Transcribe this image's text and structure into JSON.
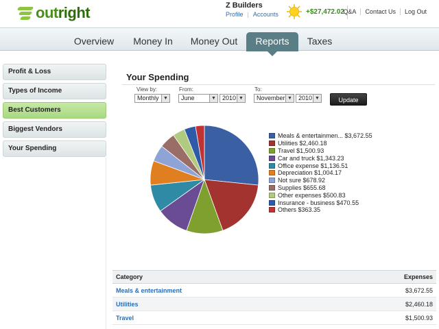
{
  "header": {
    "logo_text_a": "out",
    "logo_text_b": "right",
    "company": "Z Builders",
    "profile_link": "Profile",
    "accounts_link": "Accounts",
    "balance": "+$27,472.02",
    "links": [
      "Q&A",
      "Contact Us",
      "Log Out"
    ]
  },
  "nav": {
    "tabs": [
      "Overview",
      "Money In",
      "Money Out",
      "Reports",
      "Taxes"
    ],
    "active": "Reports"
  },
  "sidebar": {
    "items": [
      "Profit & Loss",
      "Types of Income",
      "Best Customers",
      "Biggest Vendors",
      "Your Spending"
    ],
    "active": "Best Customers"
  },
  "report": {
    "title": "Your Spending",
    "view_by_label": "View by:",
    "view_by_value": "Monthly",
    "from_label": "From:",
    "from_month": "June",
    "from_year": "2010",
    "to_label": "To:",
    "to_month": "November",
    "to_year": "2010",
    "update_label": "Update"
  },
  "chart_data": {
    "type": "pie",
    "title": "",
    "slices": [
      {
        "label": "Meals & entertainmen... $3,672.55",
        "value": 3672.55,
        "color": "#3b5fa3"
      },
      {
        "label": "Utilities $2,460.18",
        "value": 2460.18,
        "color": "#a3332f"
      },
      {
        "label": "Travel $1,500.93",
        "value": 1500.93,
        "color": "#7fa02f"
      },
      {
        "label": "Car and truck $1,343.23",
        "value": 1343.23,
        "color": "#6a4c94"
      },
      {
        "label": "Office expense $1,136.51",
        "value": 1136.51,
        "color": "#2f8aa6"
      },
      {
        "label": "Depreciation $1,004.17",
        "value": 1004.17,
        "color": "#e07f22"
      },
      {
        "label": "Not sure $678.92",
        "value": 678.92,
        "color": "#8ea3d6"
      },
      {
        "label": "Supplies $655.68",
        "value": 655.68,
        "color": "#9a6d67"
      },
      {
        "label": "Other expenses $500.83",
        "value": 500.83,
        "color": "#b0ca7f"
      },
      {
        "label": "Insurance - business $470.55",
        "value": 470.55,
        "color": "#2f5aa8"
      },
      {
        "label": "Others $363.35",
        "value": 363.35,
        "color": "#c13232"
      }
    ]
  },
  "table": {
    "col_category": "Category",
    "col_expenses": "Expenses",
    "rows": [
      {
        "category": "Meals & entertainment",
        "amount": "$3,672.55"
      },
      {
        "category": "Utilities",
        "amount": "$2,460.18"
      },
      {
        "category": "Travel",
        "amount": "$1,500.93"
      }
    ]
  }
}
